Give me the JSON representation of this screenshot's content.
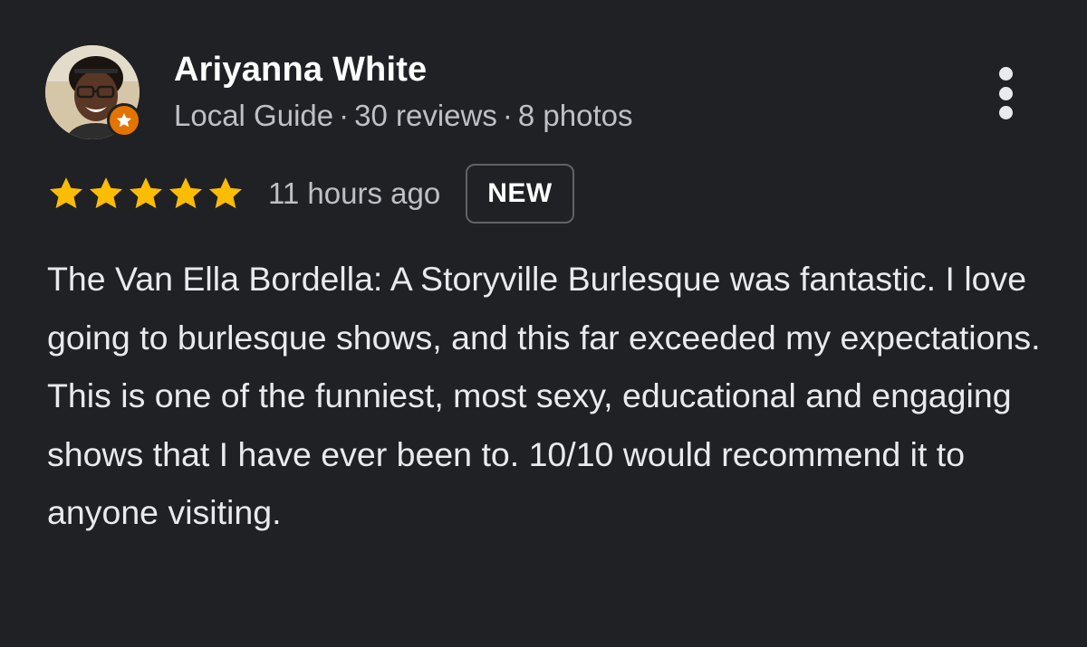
{
  "author": {
    "name": "Ariyanna White",
    "level": "Local Guide",
    "reviews": "30 reviews",
    "photos": "8 photos",
    "separator": "·",
    "avatar_icon": "user-avatar-photo",
    "badge_icon": "local-guide-star-badge"
  },
  "review": {
    "rating": 5,
    "max_rating": 5,
    "timestamp": "11 hours ago",
    "badge": "NEW",
    "text": "The Van Ella Bordella: A Storyville Burlesque was fantastic. I love going to burlesque shows, and this far exceeded my expectations. This is one of the funniest, most sexy, educational and engaging shows that I have ever been to. 10/10 would recommend it to anyone visiting."
  },
  "menu": {
    "icon": "more-vertical-icon"
  },
  "colors": {
    "background": "#202124",
    "star": "#fbbc04",
    "guide_badge": "#e37400",
    "primary_text": "#ffffff",
    "secondary_text": "#bdc1c6"
  }
}
